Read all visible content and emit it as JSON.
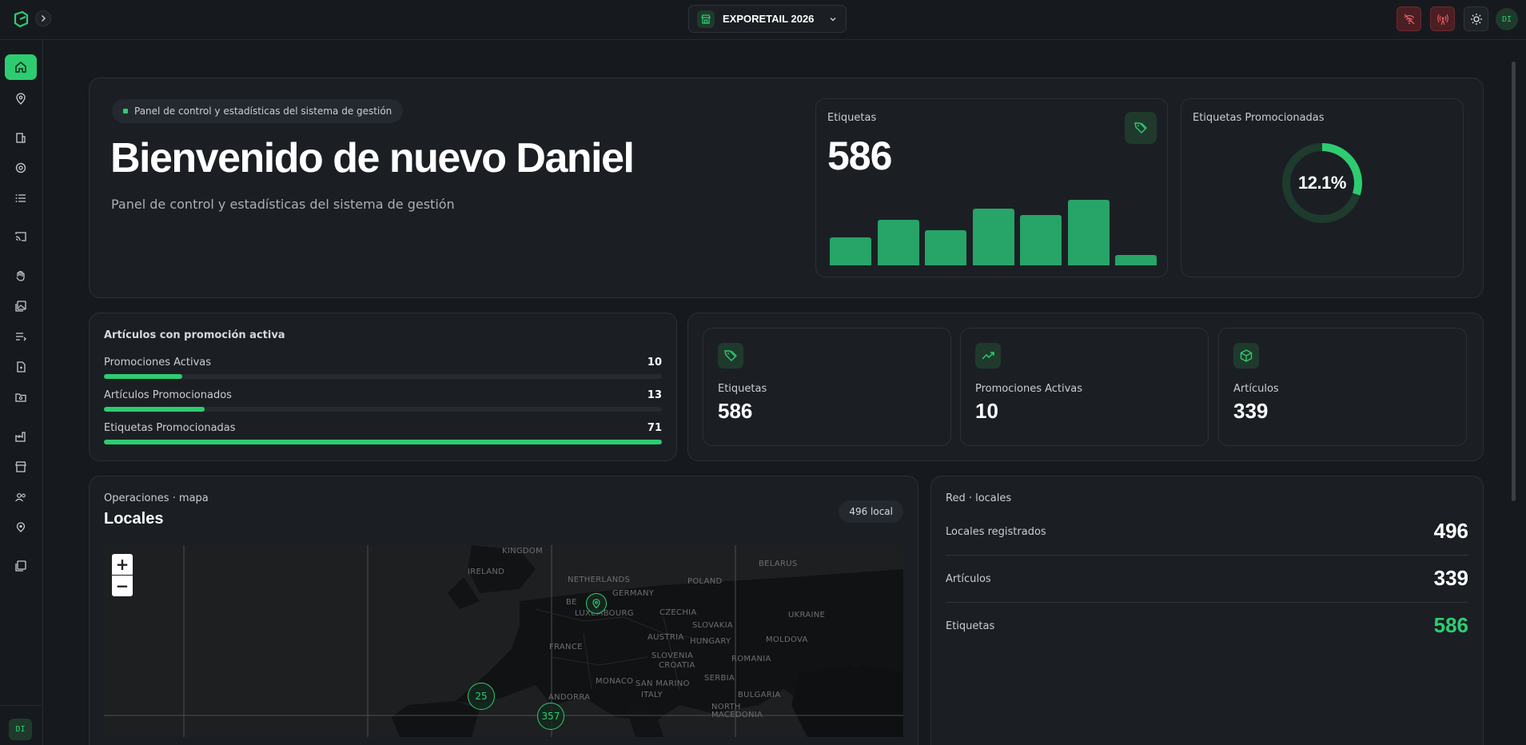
{
  "topbar": {
    "store_name": "EXPORETAIL 2026",
    "avatar_initials": "DI"
  },
  "sidebar": {
    "user_initials": "DI",
    "items": [
      "home-icon",
      "map-pin-icon",
      "building-icon",
      "settings-icon",
      "list-icon",
      "cast-icon",
      "hand-icon",
      "images-icon",
      "list-music-icon",
      "file-icon",
      "folder-search-icon",
      "factory-icon",
      "store-icon",
      "users-icon",
      "location-icon",
      "gallery-icon"
    ]
  },
  "hero": {
    "pill": "Panel de control y estadísticas del sistema de gestión",
    "title": "Bienvenido de nuevo Daniel",
    "subtitle": "Panel de control y estadísticas del sistema de gestión"
  },
  "labels_card": {
    "title": "Etiquetas",
    "value": "586",
    "bars": [
      0.42,
      0.68,
      0.52,
      0.85,
      0.75,
      0.98,
      0.16
    ]
  },
  "promo_labels_card": {
    "title": "Etiquetas Promocionadas",
    "percent_label": "12.1%",
    "percent": 12.1
  },
  "active_promo": {
    "title": "Artículos con promoción activa",
    "rows": [
      {
        "label": "Promociones Activas",
        "value": "10",
        "fraction": 0.14
      },
      {
        "label": "Artículos Promocionados",
        "value": "13",
        "fraction": 0.18
      },
      {
        "label": "Etiquetas Promocionadas",
        "value": "71",
        "fraction": 1.0
      }
    ]
  },
  "stats": [
    {
      "icon": "tag-icon",
      "label": "Etiquetas",
      "value": "586"
    },
    {
      "icon": "trending-up-icon",
      "label": "Promociones Activas",
      "value": "10"
    },
    {
      "icon": "package-icon",
      "label": "Artículos",
      "value": "339"
    }
  ],
  "map_section": {
    "eyebrow": "Operaciones · mapa",
    "title": "Locales",
    "badge": "496 local",
    "zoom_in": "+",
    "zoom_out": "−",
    "clusters": [
      "25",
      "357"
    ],
    "countries": [
      "KINGDOM",
      "IRELAND",
      "NETHERLANDS",
      "BELARUS",
      "GERMANY",
      "POLAND",
      "BE",
      "LUXEMBOURG",
      "CZECHIA",
      "UKRAINE",
      "SLOVAKIA",
      "AUSTRIA",
      "HUNGARY",
      "MOLDOVA",
      "FRANCE",
      "SLOVENIA",
      "CROATIA",
      "ROMANIA",
      "MONACO",
      "SAN MARINO",
      "ITALY",
      "SERBIA",
      "BULGARIA",
      "ANDORRA",
      "NORTH MACEDONIA"
    ]
  },
  "network": {
    "title": "Red · locales",
    "rows": [
      {
        "label": "Locales registrados",
        "value": "496"
      },
      {
        "label": "Artículos",
        "value": "339"
      },
      {
        "label": "Etiquetas",
        "value": "586"
      }
    ]
  },
  "colors": {
    "accent": "#2ecc71",
    "bar": "#27a468",
    "background": "#161a1e",
    "card": "#1b1f24"
  }
}
